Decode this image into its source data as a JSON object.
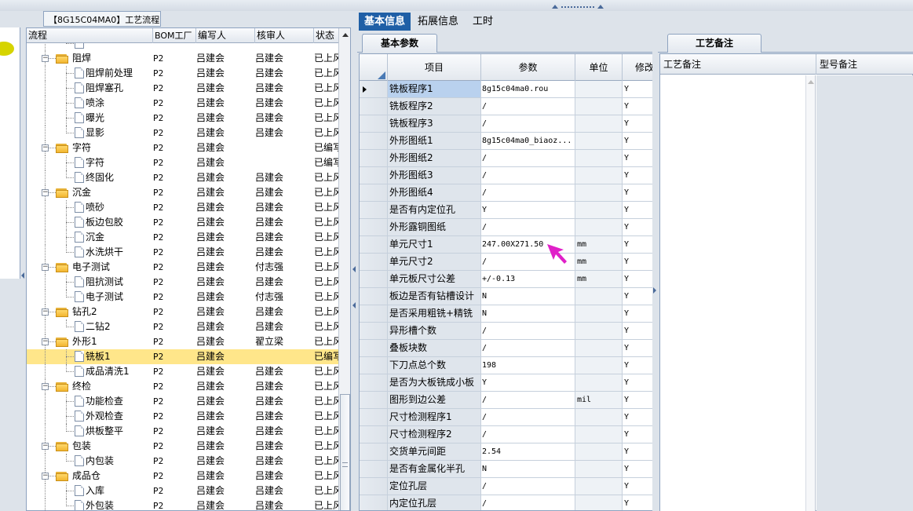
{
  "window": {
    "flow_panel_title": "【8G15C04MA0】工艺流程"
  },
  "main_tabs": [
    {
      "label": "基本信息",
      "active": true
    },
    {
      "label": "拓展信息",
      "active": false
    },
    {
      "label": "工时",
      "active": false
    }
  ],
  "tree": {
    "headers": {
      "flow": "流程",
      "bom": "BOM工厂",
      "writer": "编写人",
      "reviewer": "核审人",
      "status": "状态"
    },
    "rows": [
      {
        "level": 1,
        "type": "doc",
        "label": "",
        "bom": "",
        "writer": "",
        "reviewer": "",
        "status": ""
      },
      {
        "level": 0,
        "type": "folder",
        "label": "阻焊",
        "bom": "P2",
        "writer": "吕建会",
        "reviewer": "吕建会",
        "status": "已上风"
      },
      {
        "level": 1,
        "type": "doc",
        "label": "阻焊前处理",
        "bom": "P2",
        "writer": "吕建会",
        "reviewer": "吕建会",
        "status": "已上风"
      },
      {
        "level": 1,
        "type": "doc",
        "label": "阻焊塞孔",
        "bom": "P2",
        "writer": "吕建会",
        "reviewer": "吕建会",
        "status": "已上风"
      },
      {
        "level": 1,
        "type": "doc",
        "label": "喷涂",
        "bom": "P2",
        "writer": "吕建会",
        "reviewer": "吕建会",
        "status": "已上风"
      },
      {
        "level": 1,
        "type": "doc",
        "label": "曝光",
        "bom": "P2",
        "writer": "吕建会",
        "reviewer": "吕建会",
        "status": "已上风"
      },
      {
        "level": 1,
        "type": "doc",
        "label": "显影",
        "bom": "P2",
        "writer": "吕建会",
        "reviewer": "吕建会",
        "status": "已上风"
      },
      {
        "level": 0,
        "type": "folder",
        "label": "字符",
        "bom": "P2",
        "writer": "吕建会",
        "reviewer": "",
        "status": "已编写"
      },
      {
        "level": 1,
        "type": "doc",
        "label": "字符",
        "bom": "P2",
        "writer": "吕建会",
        "reviewer": "",
        "status": "已编写"
      },
      {
        "level": 1,
        "type": "doc",
        "label": "终固化",
        "bom": "P2",
        "writer": "吕建会",
        "reviewer": "吕建会",
        "status": "已上风"
      },
      {
        "level": 0,
        "type": "folder",
        "label": "沉金",
        "bom": "P2",
        "writer": "吕建会",
        "reviewer": "吕建会",
        "status": "已上风"
      },
      {
        "level": 1,
        "type": "doc",
        "label": "喷砂",
        "bom": "P2",
        "writer": "吕建会",
        "reviewer": "吕建会",
        "status": "已上风"
      },
      {
        "level": 1,
        "type": "doc",
        "label": "板边包胶",
        "bom": "P2",
        "writer": "吕建会",
        "reviewer": "吕建会",
        "status": "已上风"
      },
      {
        "level": 1,
        "type": "doc",
        "label": "沉金",
        "bom": "P2",
        "writer": "吕建会",
        "reviewer": "吕建会",
        "status": "已上风"
      },
      {
        "level": 1,
        "type": "doc",
        "label": "水洗烘干",
        "bom": "P2",
        "writer": "吕建会",
        "reviewer": "吕建会",
        "status": "已上风"
      },
      {
        "level": 0,
        "type": "folder",
        "label": "电子测试",
        "bom": "P2",
        "writer": "吕建会",
        "reviewer": "付志强",
        "status": "已上风"
      },
      {
        "level": 1,
        "type": "doc",
        "label": "阻抗测试",
        "bom": "P2",
        "writer": "吕建会",
        "reviewer": "吕建会",
        "status": "已上风"
      },
      {
        "level": 1,
        "type": "doc",
        "label": "电子测试",
        "bom": "P2",
        "writer": "吕建会",
        "reviewer": "付志强",
        "status": "已上风"
      },
      {
        "level": 0,
        "type": "folder",
        "label": "钻孔2",
        "bom": "P2",
        "writer": "吕建会",
        "reviewer": "吕建会",
        "status": "已上风"
      },
      {
        "level": 1,
        "type": "doc",
        "label": "二钻2",
        "bom": "P2",
        "writer": "吕建会",
        "reviewer": "吕建会",
        "status": "已上风"
      },
      {
        "level": 0,
        "type": "folder",
        "label": "外形1",
        "bom": "P2",
        "writer": "吕建会",
        "reviewer": "翟立梁",
        "status": "已上风"
      },
      {
        "level": 1,
        "type": "doc",
        "label": "铣板1",
        "bom": "P2",
        "writer": "吕建会",
        "reviewer": "",
        "status": "已编写",
        "selected": true
      },
      {
        "level": 1,
        "type": "doc",
        "label": "成品清洗1",
        "bom": "P2",
        "writer": "吕建会",
        "reviewer": "吕建会",
        "status": "已上风"
      },
      {
        "level": 0,
        "type": "folder",
        "label": "终检",
        "bom": "P2",
        "writer": "吕建会",
        "reviewer": "吕建会",
        "status": "已上风"
      },
      {
        "level": 1,
        "type": "doc",
        "label": "功能检查",
        "bom": "P2",
        "writer": "吕建会",
        "reviewer": "吕建会",
        "status": "已上风"
      },
      {
        "level": 1,
        "type": "doc",
        "label": "外观检查",
        "bom": "P2",
        "writer": "吕建会",
        "reviewer": "吕建会",
        "status": "已上风"
      },
      {
        "level": 1,
        "type": "doc",
        "label": "烘板整平",
        "bom": "P2",
        "writer": "吕建会",
        "reviewer": "吕建会",
        "status": "已上风"
      },
      {
        "level": 0,
        "type": "folder",
        "label": "包装",
        "bom": "P2",
        "writer": "吕建会",
        "reviewer": "吕建会",
        "status": "已上风"
      },
      {
        "level": 1,
        "type": "doc",
        "label": "内包装",
        "bom": "P2",
        "writer": "吕建会",
        "reviewer": "吕建会",
        "status": "已上风"
      },
      {
        "level": 0,
        "type": "folder",
        "label": "成品仓",
        "bom": "P2",
        "writer": "吕建会",
        "reviewer": "吕建会",
        "status": "已上风"
      },
      {
        "level": 1,
        "type": "doc",
        "label": "入库",
        "bom": "P2",
        "writer": "吕建会",
        "reviewer": "吕建会",
        "status": "已上风"
      },
      {
        "level": 1,
        "type": "doc",
        "label": "外包装",
        "bom": "P2",
        "writer": "吕建会",
        "reviewer": "吕建会",
        "status": "已上风"
      }
    ]
  },
  "basic_params": {
    "tab_label": "基本参数",
    "headers": {
      "item": "项目",
      "param": "参数",
      "unit": "单位",
      "modify": "修改"
    },
    "rows": [
      {
        "item": "铣板程序1",
        "param": "8g15c04ma0.rou",
        "unit": "",
        "modify": "Y"
      },
      {
        "item": "铣板程序2",
        "param": "/",
        "unit": "",
        "modify": "Y"
      },
      {
        "item": "铣板程序3",
        "param": "/",
        "unit": "",
        "modify": "Y"
      },
      {
        "item": "外形图纸1",
        "param": "8g15c04ma0_biaoz...",
        "unit": "",
        "modify": "Y"
      },
      {
        "item": "外形图纸2",
        "param": "/",
        "unit": "",
        "modify": "Y"
      },
      {
        "item": "外形图纸3",
        "param": "/",
        "unit": "",
        "modify": "Y"
      },
      {
        "item": "外形图纸4",
        "param": "/",
        "unit": "",
        "modify": "Y"
      },
      {
        "item": "是否有内定位孔",
        "param": "Y",
        "unit": "",
        "modify": "Y"
      },
      {
        "item": "外形露铜图纸",
        "param": "/",
        "unit": "",
        "modify": "Y"
      },
      {
        "item": "单元尺寸1",
        "param": "247.00X271.50",
        "unit": "mm",
        "modify": "Y"
      },
      {
        "item": "单元尺寸2",
        "param": "/",
        "unit": "mm",
        "modify": "Y"
      },
      {
        "item": "单元板尺寸公差",
        "param": "+/-0.13",
        "unit": "mm",
        "modify": "Y"
      },
      {
        "item": "板边是否有钻槽设计",
        "param": "N",
        "unit": "",
        "modify": "Y"
      },
      {
        "item": "是否采用粗铣+精铣",
        "param": "N",
        "unit": "",
        "modify": "Y"
      },
      {
        "item": "异形槽个数",
        "param": "/",
        "unit": "",
        "modify": "Y"
      },
      {
        "item": "叠板块数",
        "param": "/",
        "unit": "",
        "modify": "Y"
      },
      {
        "item": "下刀点总个数",
        "param": "198",
        "unit": "",
        "modify": "Y"
      },
      {
        "item": "是否为大板铣成小板",
        "param": "Y",
        "unit": "",
        "modify": "Y"
      },
      {
        "item": "图形到边公差",
        "param": "/",
        "unit": "mil",
        "modify": "Y"
      },
      {
        "item": "尺寸检测程序1",
        "param": "/",
        "unit": "",
        "modify": "Y"
      },
      {
        "item": "尺寸检测程序2",
        "param": "/",
        "unit": "",
        "modify": "Y"
      },
      {
        "item": "交货单元间距",
        "param": "2.54",
        "unit": "",
        "modify": "Y"
      },
      {
        "item": "是否有金属化半孔",
        "param": "N",
        "unit": "",
        "modify": "Y"
      },
      {
        "item": "定位孔层",
        "param": "/",
        "unit": "",
        "modify": "Y"
      },
      {
        "item": "内定位孔层",
        "param": "/",
        "unit": "",
        "modify": "Y"
      }
    ]
  },
  "process_notes": {
    "tab_label": "工艺备注",
    "headers": {
      "process_note": "工艺备注",
      "model_note": "型号备注"
    }
  },
  "colors": {
    "active_tab": "#1f5fa6",
    "selected_row": "#ffe68a",
    "cursor": "#e020c8"
  }
}
